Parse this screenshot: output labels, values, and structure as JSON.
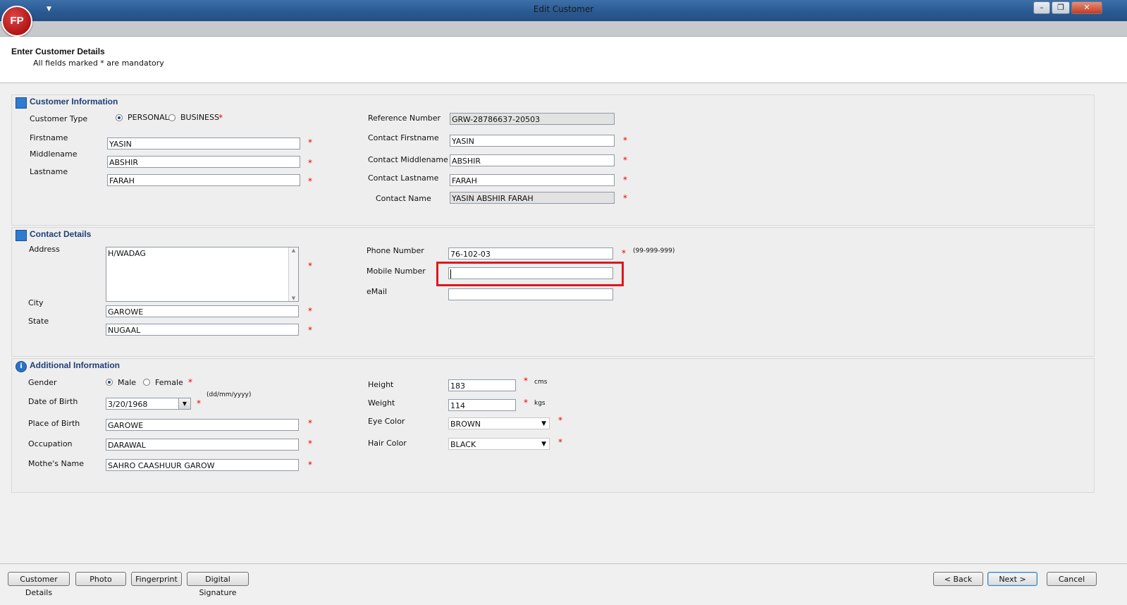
{
  "window": {
    "title": "Edit Customer",
    "logo_text": "FP",
    "controls": {
      "minimize": "–",
      "restore": "❐",
      "close": "✕"
    }
  },
  "header": {
    "title": "Enter Customer Details",
    "subtitle": "All fields marked * are mandatory"
  },
  "customer_info": {
    "section_title": "Customer Information",
    "customer_type_label": "Customer Type",
    "personal_label": "PERSONAL",
    "business_label": "BUSINESS",
    "selected_type": "PERSONAL",
    "firstname_label": "Firstname",
    "firstname": "YASIN",
    "middlename_label": "Middlename",
    "middlename": "ABSHIR",
    "lastname_label": "Lastname",
    "lastname": "FARAH",
    "reference_label": "Reference Number",
    "reference": "GRW-28786637-20503",
    "contact_firstname_label": "Contact Firstname",
    "contact_firstname": "YASIN",
    "contact_middlename_label": "Contact Middlename",
    "contact_middlename": "ABSHIR",
    "contact_lastname_label": "Contact Lastname",
    "contact_lastname": "FARAH",
    "contact_name_label": "Contact Name",
    "contact_name": "YASIN ABSHIR FARAH"
  },
  "contact_details": {
    "section_title": "Contact Details",
    "address_label": "Address",
    "address": "H/WADAG",
    "city_label": "City",
    "city": "GAROWE",
    "state_label": "State",
    "state": "NUGAAL",
    "phone_label": "Phone Number",
    "phone": "76-102-03",
    "phone_format": "(99-999-999)",
    "mobile_label": "Mobile Number",
    "mobile": "",
    "email_label": "eMail",
    "email": ""
  },
  "additional_info": {
    "section_title": "Additional Information",
    "gender_label": "Gender",
    "male_label": "Male",
    "female_label": "Female",
    "selected_gender": "Male",
    "dob_label": "Date of Birth",
    "dob": "3/20/1968",
    "dob_format": "(dd/mm/yyyy)",
    "pob_label": "Place of Birth",
    "pob": "GAROWE",
    "occupation_label": "Occupation",
    "occupation": "DARAWAL",
    "mother_label": "Mothe's Name",
    "mother": "SAHRO CAASHUUR GAROW",
    "height_label": "Height",
    "height": "183",
    "height_unit": "cms",
    "weight_label": "Weight",
    "weight": "114",
    "weight_unit": "kgs",
    "eye_label": "Eye Color",
    "eye": "BROWN",
    "hair_label": "Hair Color",
    "hair": "BLACK"
  },
  "required_mark": "*",
  "footer": {
    "customer_details": "Customer Details",
    "photo": "Photo",
    "fingerprint": "Fingerprint",
    "digital_signature": "Digital Signature",
    "back": "< Back",
    "next": "Next >",
    "cancel": "Cancel"
  },
  "colors": {
    "highlight": "#e0161f",
    "section_title": "#1f3f78",
    "required": "#e00000"
  }
}
